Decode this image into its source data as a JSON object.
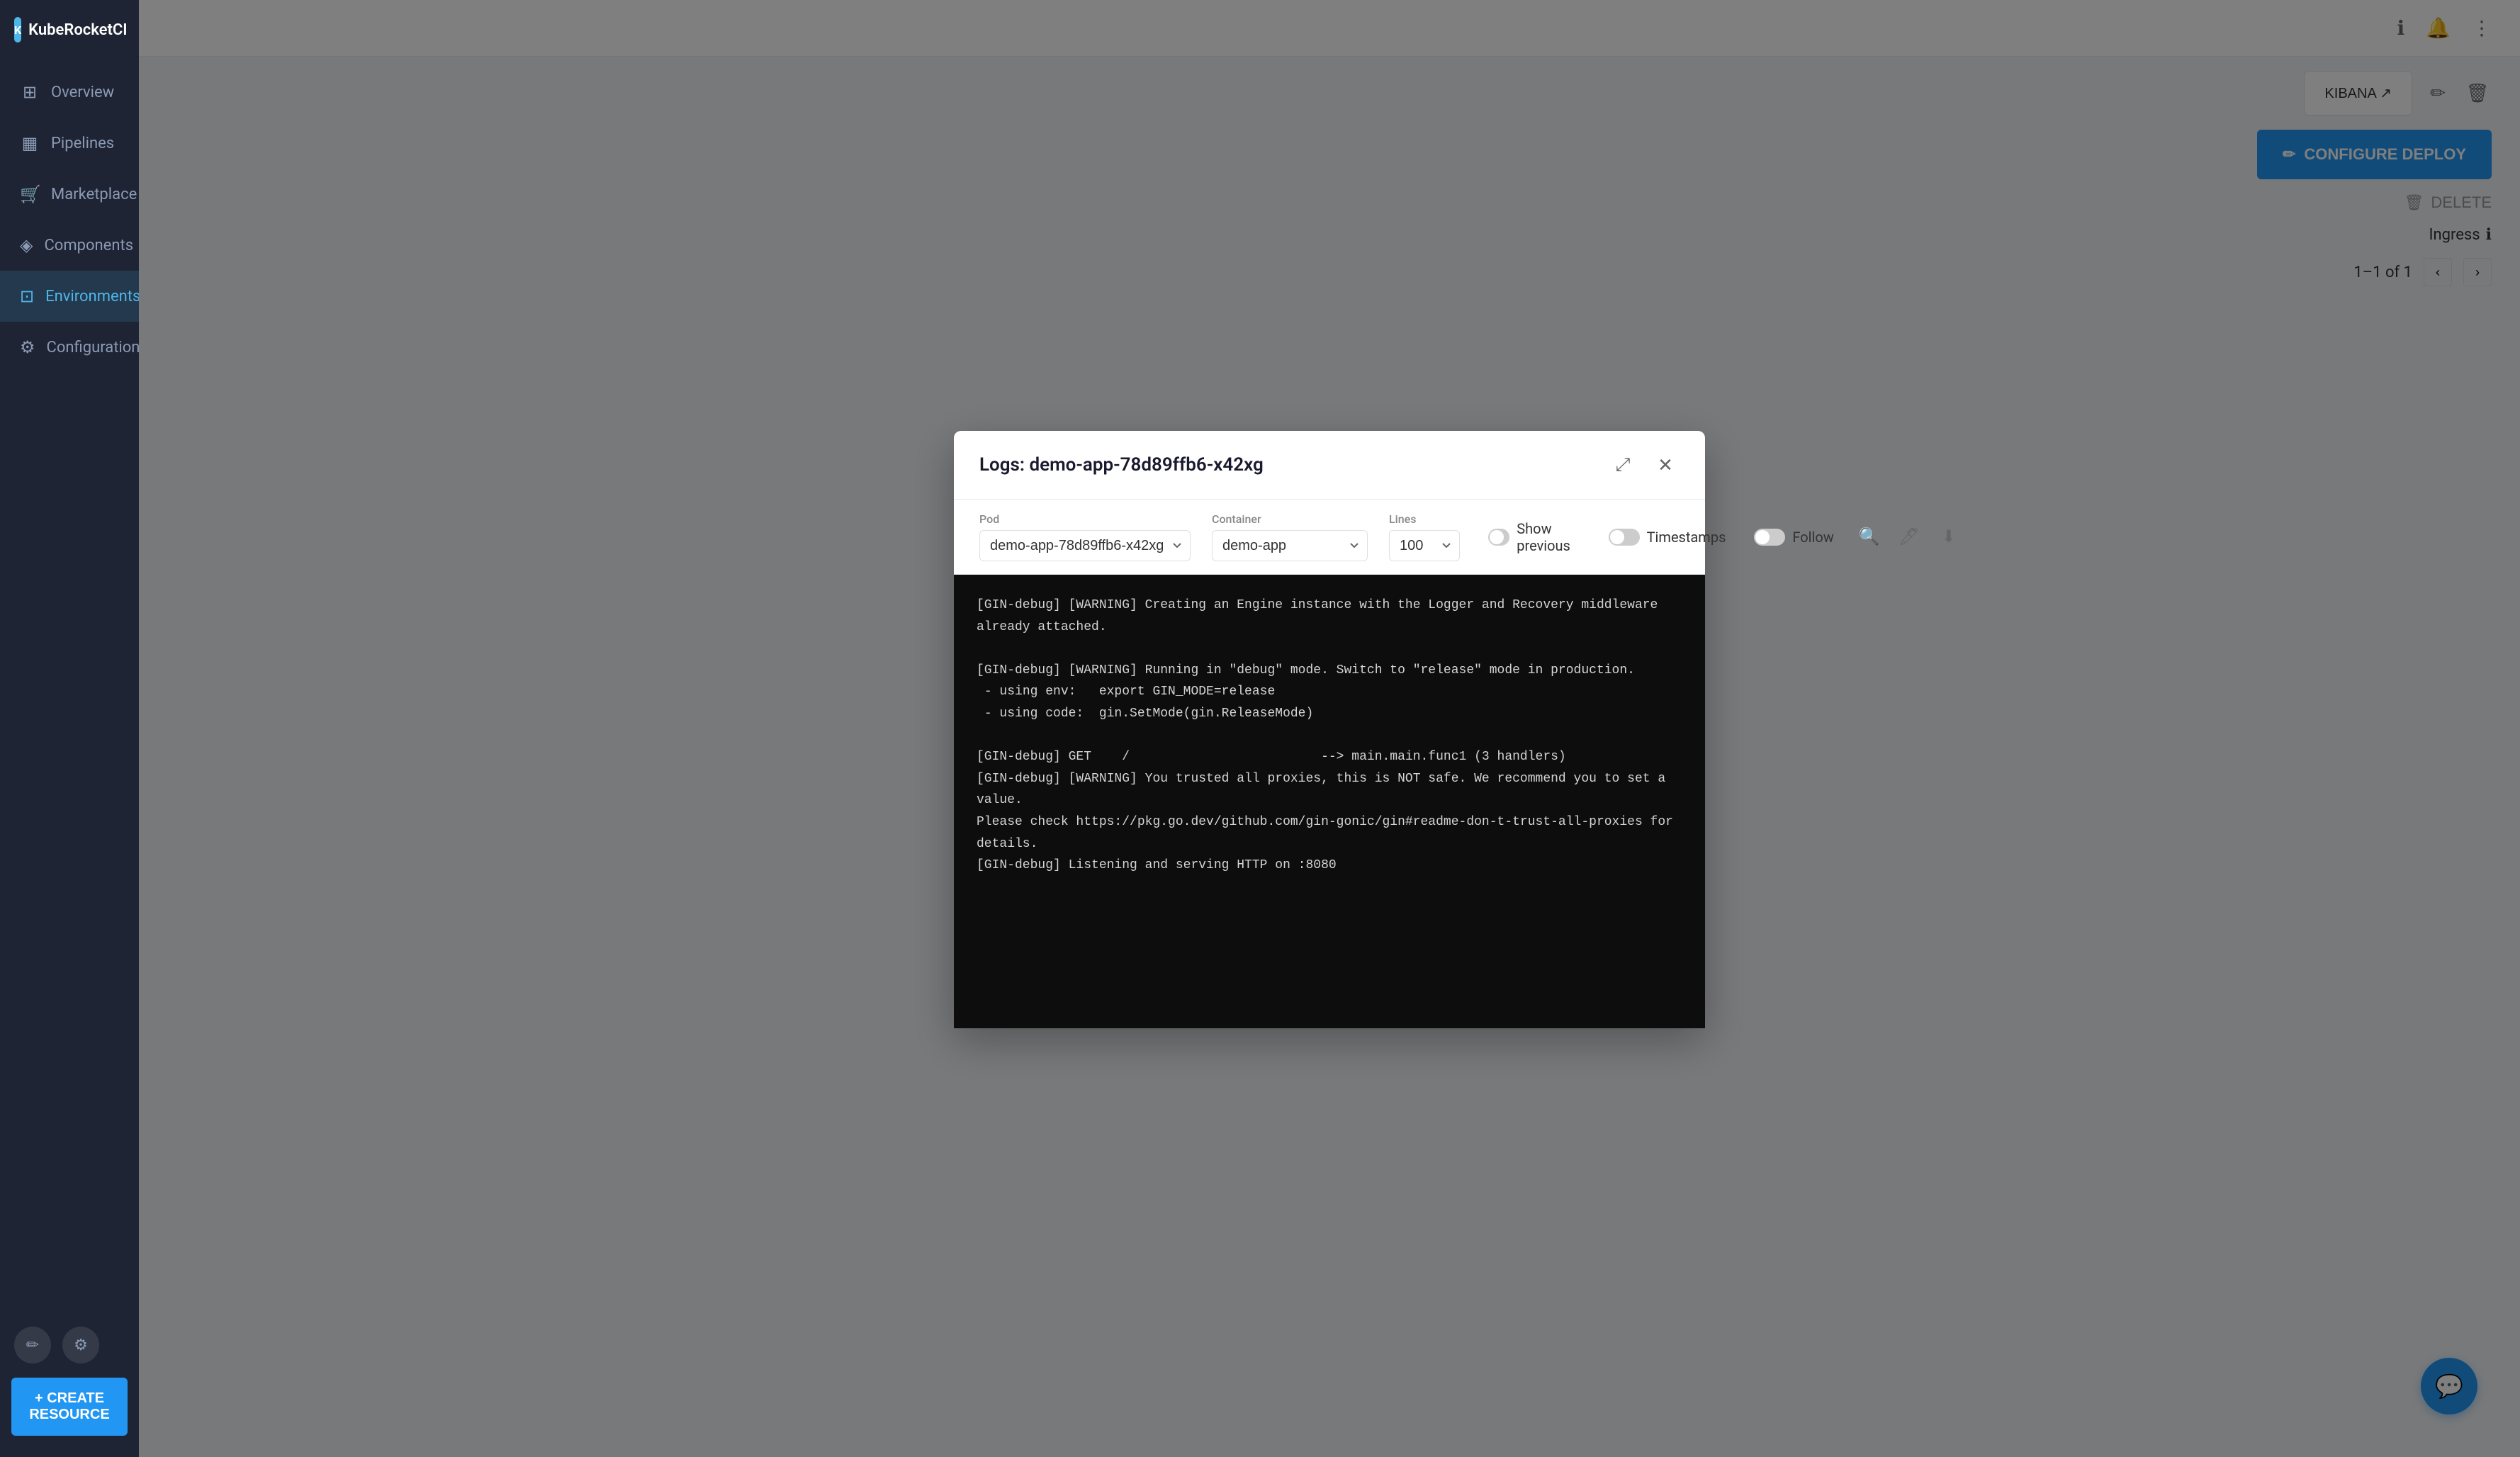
{
  "sidebar": {
    "logo": {
      "icon_text": "K",
      "text": "KubeRocketCI"
    },
    "nav_items": [
      {
        "id": "overview",
        "label": "Overview",
        "icon": "⊞",
        "active": false
      },
      {
        "id": "pipelines",
        "label": "Pipelines",
        "icon": "▦",
        "active": false
      },
      {
        "id": "marketplace",
        "label": "Marketplace",
        "icon": "🛒",
        "active": false
      },
      {
        "id": "components",
        "label": "Components",
        "icon": "◈",
        "active": false
      },
      {
        "id": "environments",
        "label": "Environments",
        "icon": "⊡",
        "active": true
      },
      {
        "id": "configuration",
        "label": "Configuration",
        "icon": "⚙",
        "active": false
      }
    ],
    "bottom_icons": [
      "✏",
      "⚙"
    ],
    "create_resource_btn": "+ CREATE RESOURCE"
  },
  "topbar": {
    "icons": [
      "ℹ",
      "🔔",
      "⋮"
    ]
  },
  "right_panel": {
    "configure_deploy_btn": "CONFIGURE DEPLOY",
    "kibana_btn": "KIBANA ↗",
    "delete_btn": "DELETE",
    "ingress_label": "Ingress",
    "pagination": "1–1 of 1"
  },
  "modal": {
    "title": "Logs: demo-app-78d89ffb6-x42xg",
    "pod_label": "Pod",
    "pod_value": "demo-app-78d89ffb6-x42xg",
    "container_label": "Container",
    "container_value": "demo-app",
    "lines_label": "Lines",
    "lines_value": "100",
    "show_previous_label": "Show previous",
    "show_previous_enabled": false,
    "timestamps_label": "Timestamps",
    "timestamps_enabled": false,
    "follow_label": "Follow",
    "follow_enabled": false,
    "log_content": "[GIN-debug] [WARNING] Creating an Engine instance with the Logger and Recovery middleware already attached.\n\n[GIN-debug] [WARNING] Running in \"debug\" mode. Switch to \"release\" mode in production.\n - using env:\texport GIN_MODE=release\n - using code:\tgin.SetMode(gin.ReleaseMode)\n\n[GIN-debug] GET    /                         --> main.main.func1 (3 handlers)\n[GIN-debug] [WARNING] You trusted all proxies, this is NOT safe. We recommend you to set a value.\nPlease check https://pkg.go.dev/github.com/gin-gonic/gin#readme-don-t-trust-all-proxies for details.\n[GIN-debug] Listening and serving HTTP on :8080"
  }
}
